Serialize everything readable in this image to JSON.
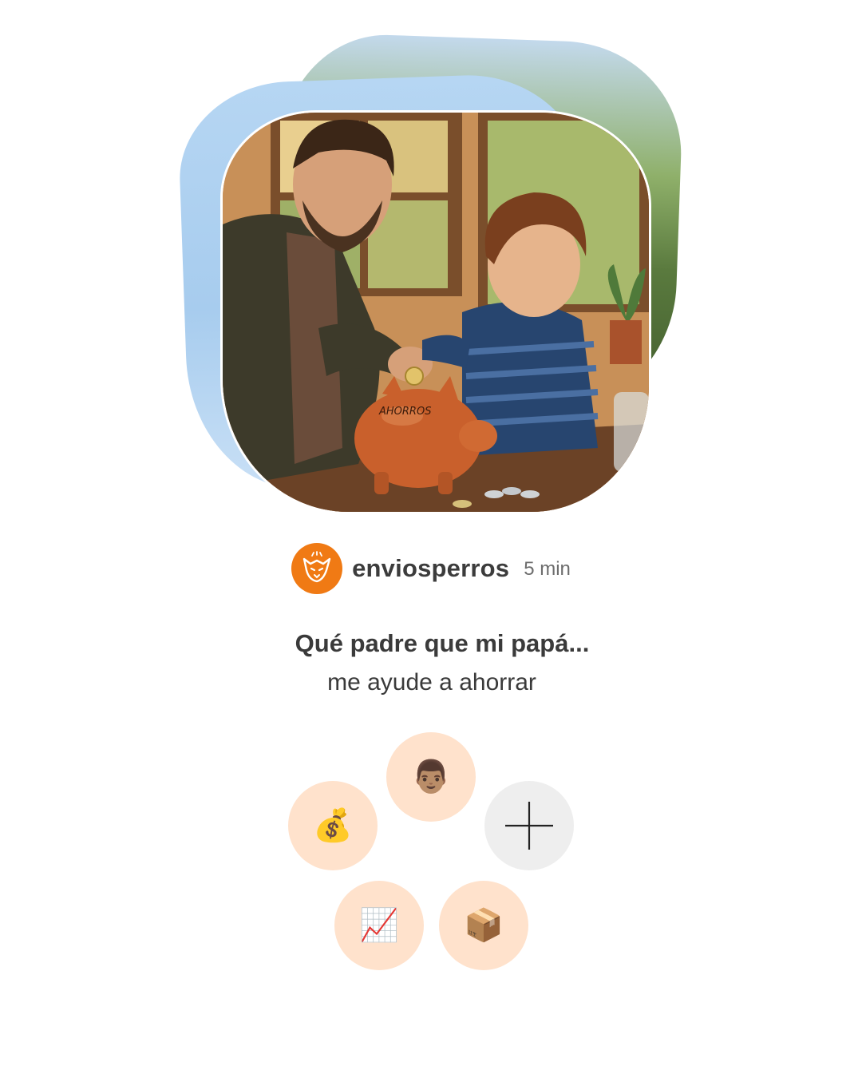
{
  "post": {
    "author": {
      "username": "enviosperros",
      "time": "5 min",
      "avatar_icon": "fox-logo-icon",
      "avatar_color": "#f07a14"
    },
    "title": "Qué padre que mi papá...",
    "subtitle": "me ayude a ahorrar",
    "image": {
      "piggy_bank_label": "AHORROS"
    }
  },
  "reactions": [
    {
      "icon": "money-bag-icon",
      "emoji": "💰"
    },
    {
      "icon": "man-face-icon",
      "emoji": "👨🏽"
    },
    {
      "icon": "add-reaction-icon",
      "emoji": "+"
    },
    {
      "icon": "chart-increasing-icon",
      "emoji": "📈"
    },
    {
      "icon": "package-icon",
      "emoji": "📦"
    }
  ],
  "colors": {
    "bubble_bg": "#ffe2cc",
    "add_bubble_bg": "#eeeeee",
    "text": "#3a3a3a",
    "muted_text": "#6d6d6d"
  }
}
